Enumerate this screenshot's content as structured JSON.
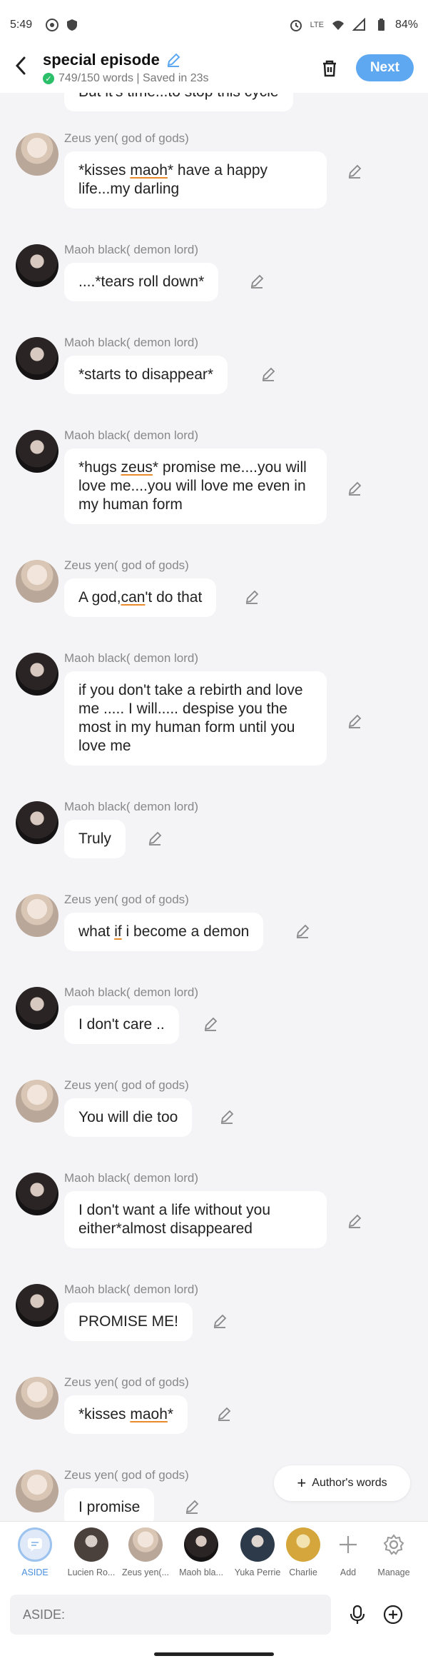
{
  "status_bar": {
    "time": "5:49",
    "battery": "84%",
    "network": "LTE"
  },
  "header": {
    "back_icon": "chevron-left-icon",
    "title": "special episode",
    "words_saved": "749/150 words | Saved in 23s",
    "next_label": "Next",
    "accent": "#5ea8f2"
  },
  "chat": {
    "partial_top": "But it's time...to stop this cycle",
    "messages": [
      {
        "speaker": "Zeus yen( god of gods)",
        "text": "*kisses maoh* have a happy life...my darling"
      },
      {
        "speaker": "Maoh black( demon lord)",
        "text": "....*tears roll down*"
      },
      {
        "speaker": "Maoh black( demon lord)",
        "text": "*starts to disappear*"
      },
      {
        "speaker": "Maoh black( demon lord)",
        "text": "*hugs zeus* promise me....you will love me....you will love me even in my human form"
      },
      {
        "speaker": "Zeus yen( god of gods)",
        "text": "A god,can't do that"
      },
      {
        "speaker": "Maoh black( demon lord)",
        "text": "if you don't take a rebirth and love me ..... I will..... despise you the most in my human form until you love me"
      },
      {
        "speaker": "Maoh black( demon lord)",
        "text": "Truly"
      },
      {
        "speaker": "Zeus yen( god of gods)",
        "text": "what if i become a demon"
      },
      {
        "speaker": "Maoh black( demon lord)",
        "text": "I don't care .."
      },
      {
        "speaker": "Zeus yen( god of gods)",
        "text": "You will die too"
      },
      {
        "speaker": "Maoh black( demon lord)",
        "text": "I don't want a life without you either*almost disappeared"
      },
      {
        "speaker": "Maoh black( demon lord)",
        "text": "PROMISE ME!"
      },
      {
        "speaker": "Zeus yen( god of gods)",
        "text": "*kisses maoh*"
      },
      {
        "speaker": "Zeus yen( god of gods)",
        "text": "I promise"
      }
    ]
  },
  "authors_words_label": "Author's words",
  "characters": [
    {
      "name": "ASIDE"
    },
    {
      "name": "Lucien Ro..."
    },
    {
      "name": "Zeus yen(..."
    },
    {
      "name": "Maoh bla..."
    },
    {
      "name": "Yuka Perrie"
    },
    {
      "name": "Charlie"
    },
    {
      "name": "Add"
    },
    {
      "name": "Manage"
    }
  ],
  "input": {
    "placeholder": "ASIDE:"
  }
}
